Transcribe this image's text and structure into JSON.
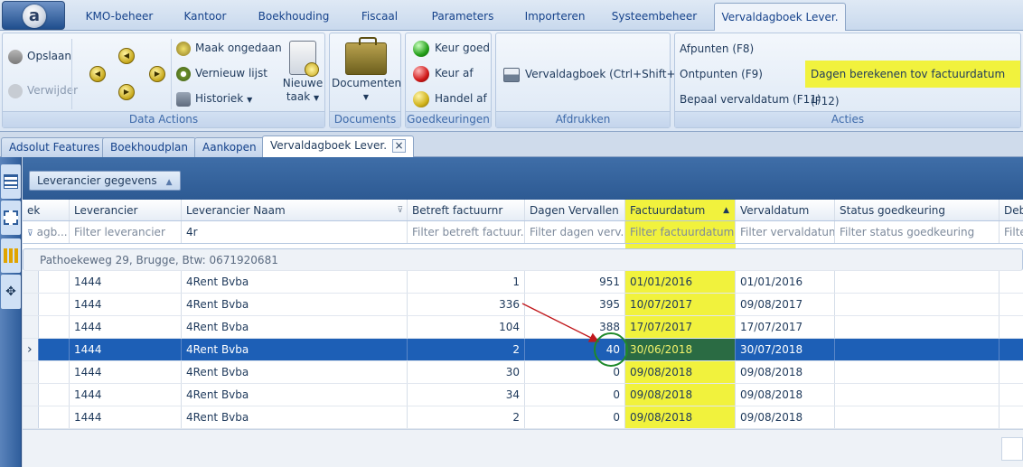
{
  "app": {
    "orb_letter": "a"
  },
  "ribbon_tabs": [
    "KMO-beheer",
    "Kantoor",
    "Boekhouding",
    "Fiscaal",
    "Parameters",
    "Importeren",
    "Systeembeheer",
    "Vervaldagboek Lever."
  ],
  "ribbon": {
    "data_actions": {
      "caption": "Data Actions",
      "save": "Opslaan",
      "delete": "Verwijder",
      "undo": "Maak ongedaan",
      "refresh": "Vernieuw lijst",
      "history": "Historiek",
      "new_task_line1": "Nieuwe",
      "new_task_line2": "taak"
    },
    "documents": {
      "caption": "Documents",
      "label": "Documenten"
    },
    "approvals": {
      "caption": "Goedkeuringen",
      "approve": "Keur goed",
      "reject": "Keur af",
      "trade": "Handel af"
    },
    "print": {
      "caption": "Afdrukken",
      "label": "Vervaldagboek (Ctrl+Shift+V)"
    },
    "actions": {
      "caption": "Acties",
      "afpunten": "Afpunten (F8)",
      "ontpunten": "Ontpunten (F9)",
      "bepaal": "Bepaal vervaldatum (F11)",
      "dagen": "Dagen berekenen tov factuurdatum (F12)"
    }
  },
  "doc_tabs": [
    "Adsolut Features",
    "Boekhoudplan",
    "Aankopen",
    "Vervaldagboek Lever."
  ],
  "doc_tab_close": "×",
  "group_chip": "Leverancier gegevens",
  "grid": {
    "columns": [
      "ek",
      "Leverancier",
      "Leverancier Naam",
      "Betreft factuurnr",
      "Dagen Vervallen",
      "Factuurdatum",
      "Vervaldatum",
      "Status goedkeuring",
      "Deb"
    ],
    "filters": [
      "agb...",
      "Filter leverancier",
      "4r",
      "Filter betreft factuur...",
      "Filter dagen verv...",
      "Filter factuurdatum",
      "Filter vervaldatum",
      "Filter status goedkeuring",
      "Filte"
    ],
    "group_label": "Pathoekeweg 29, Brugge, Btw: 0671920681",
    "rows": [
      {
        "lev": "1444",
        "naam": "4Rent Bvba",
        "factuurnr": "1",
        "dagen": "951",
        "factuurdatum": "01/01/2016",
        "vervaldatum": "01/01/2016"
      },
      {
        "lev": "1444",
        "naam": "4Rent Bvba",
        "factuurnr": "336",
        "dagen": "395",
        "factuurdatum": "10/07/2017",
        "vervaldatum": "09/08/2017"
      },
      {
        "lev": "1444",
        "naam": "4Rent Bvba",
        "factuurnr": "104",
        "dagen": "388",
        "factuurdatum": "17/07/2017",
        "vervaldatum": "17/07/2017"
      },
      {
        "lev": "1444",
        "naam": "4Rent Bvba",
        "factuurnr": "2",
        "dagen": "40",
        "factuurdatum": "30/06/2018",
        "vervaldatum": "30/07/2018"
      },
      {
        "lev": "1444",
        "naam": "4Rent Bvba",
        "factuurnr": "30",
        "dagen": "0",
        "factuurdatum": "09/08/2018",
        "vervaldatum": "09/08/2018"
      },
      {
        "lev": "1444",
        "naam": "4Rent Bvba",
        "factuurnr": "34",
        "dagen": "0",
        "factuurdatum": "09/08/2018",
        "vervaldatum": "09/08/2018"
      },
      {
        "lev": "1444",
        "naam": "4Rent Bvba",
        "factuurnr": "2",
        "dagen": "0",
        "factuurdatum": "09/08/2018",
        "vervaldatum": "09/08/2018"
      }
    ],
    "selected_row_index": 3
  },
  "colors": {
    "highlight": "#f1f23d",
    "selection": "#1d5fb6",
    "annotation_arrow": "#c0181c",
    "annotation_circle": "#1f8a2a"
  }
}
